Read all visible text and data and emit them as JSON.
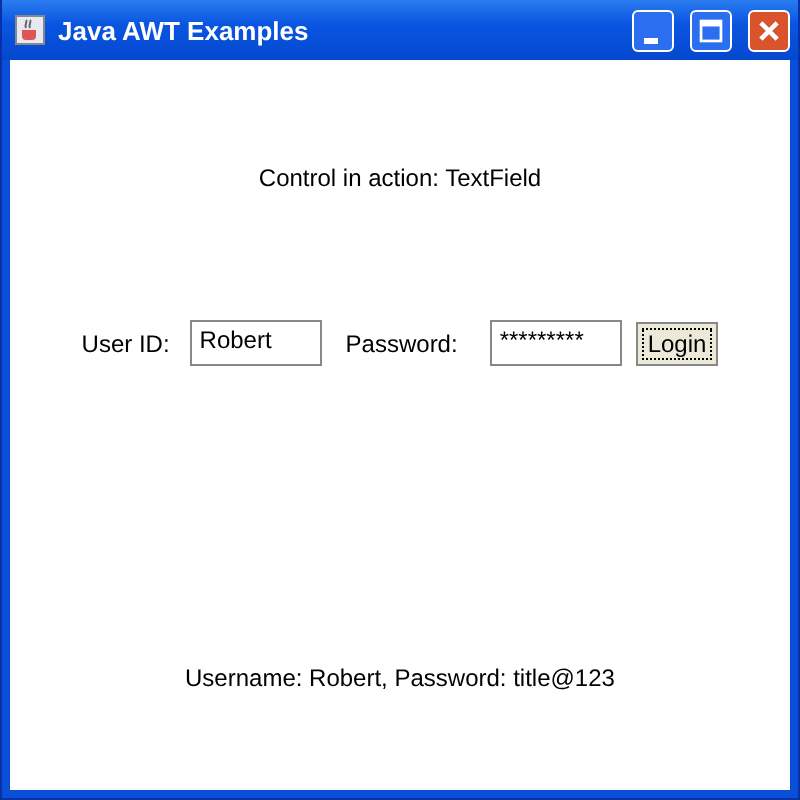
{
  "window": {
    "title": "Java AWT Examples"
  },
  "header": "Control in action: TextField",
  "form": {
    "user_label": "User ID:",
    "user_value": "Robert",
    "password_label": "Password:",
    "password_value": "*********",
    "login_button": "Login"
  },
  "status": "Username: Robert, Password: title@123"
}
